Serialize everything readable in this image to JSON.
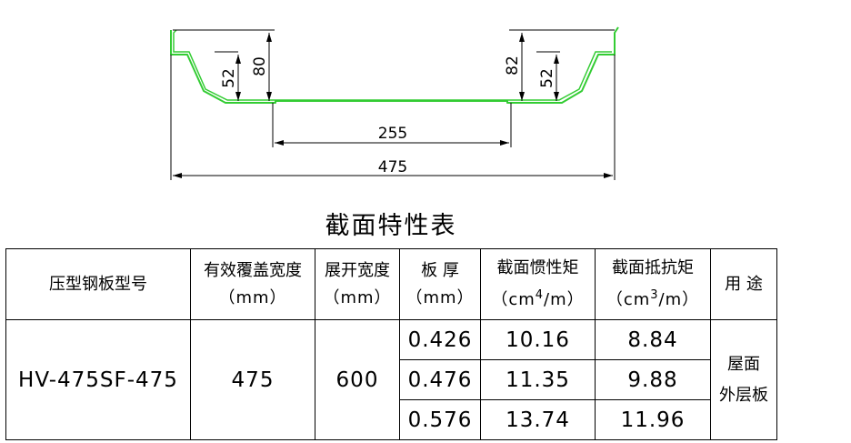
{
  "drawing": {
    "dims": {
      "total_width": "475",
      "bottom_width": "255",
      "left_height": "80",
      "left_sub": "52",
      "right_height": "82",
      "right_sub": "52"
    },
    "colors": {
      "profile": "#33cc33",
      "dimension": "#000000"
    }
  },
  "table": {
    "title": "截面特性表",
    "headers": {
      "model": "压型钢板型号",
      "width_l1": "有效覆盖宽度",
      "width_l2": "（mm）",
      "unfold_l1": "展开宽度",
      "unfold_l2": "（mm）",
      "thick_l1": "板 厚",
      "thick_l2": "（mm）",
      "inertia_l1": "截面惯性矩",
      "inertia_l2a": "（cm",
      "inertia_sup": "4",
      "inertia_l2b": "/m）",
      "resist_l1": "截面抵抗矩",
      "resist_l2a": "（cm",
      "resist_sup": "3",
      "resist_l2b": "/m）",
      "usage": "用 途"
    },
    "model": "HV-475SF-475",
    "cover_width": "475",
    "unfold_width": "600",
    "rows": [
      {
        "thickness": "0.426",
        "inertia": "10.16",
        "resistance": "8.84"
      },
      {
        "thickness": "0.476",
        "inertia": "11.35",
        "resistance": "9.88"
      },
      {
        "thickness": "0.576",
        "inertia": "13.74",
        "resistance": "11.96"
      }
    ],
    "usage_l1": "屋面",
    "usage_l2": "外层板"
  }
}
